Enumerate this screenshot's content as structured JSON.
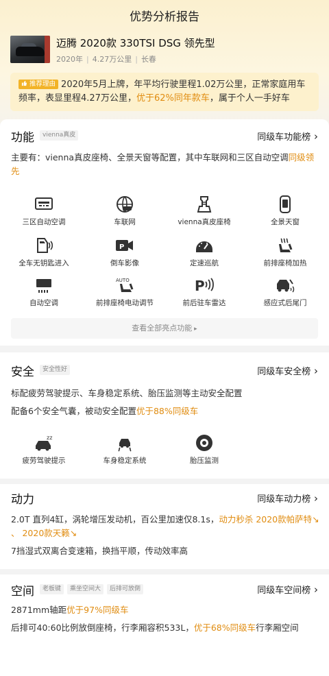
{
  "header": {
    "title": "优势分析报告"
  },
  "car": {
    "name": "迈腾 2020款 330TSI DSG 领先型",
    "year": "2020年",
    "mileage": "4.27万公里",
    "city": "长春"
  },
  "recommend": {
    "tag": "推荐理由",
    "text_1": "2020年5月上牌，年平均行驶里程1.02万公里，正常家庭用车频率，表显里程4.27万公里，",
    "highlight": "优于62%同年款车",
    "text_2": "，属于个人一手好车"
  },
  "features": {
    "title": "功能",
    "tag": "vienna真皮",
    "rank_label": "同级车功能榜",
    "desc_1": "主要有：vienna真皮座椅、全景天窗等配置，其中车联网和三区自动空调",
    "desc_highlight": "同级领先",
    "items": [
      {
        "label": "三区自动空调",
        "icon": "tri-zone-ac-icon"
      },
      {
        "label": "车联网",
        "icon": "connected-car-icon"
      },
      {
        "label": "vienna真皮座椅",
        "icon": "leather-seat-icon"
      },
      {
        "label": "全景天窗",
        "icon": "panoramic-roof-icon"
      },
      {
        "label": "全车无钥匙进入",
        "icon": "keyless-entry-icon"
      },
      {
        "label": "倒车影像",
        "icon": "rear-camera-icon"
      },
      {
        "label": "定速巡航",
        "icon": "cruise-control-icon"
      },
      {
        "label": "前排座椅加热",
        "icon": "seat-heating-icon"
      },
      {
        "label": "自动空调",
        "icon": "auto-ac-icon"
      },
      {
        "label": "前排座椅电动调节",
        "icon": "power-seat-icon"
      },
      {
        "label": "前后驻车雷达",
        "icon": "parking-radar-icon"
      },
      {
        "label": "感应式后尾门",
        "icon": "sensor-tailgate-icon"
      }
    ],
    "view_all": "查看全部亮点功能"
  },
  "safety": {
    "title": "安全",
    "tag": "安全性好",
    "rank_label": "同级车安全榜",
    "desc_1": "标配疲劳驾驶提示、车身稳定系统、胎压监测等主动安全配置",
    "desc_2": "配备6个安全气囊，被动安全配置",
    "desc_2_highlight": "优于88%同级车",
    "items": [
      {
        "label": "疲劳驾驶提示",
        "icon": "fatigue-alert-icon"
      },
      {
        "label": "车身稳定系统",
        "icon": "stability-control-icon"
      },
      {
        "label": "胎压监测",
        "icon": "tire-pressure-icon"
      }
    ]
  },
  "power": {
    "title": "动力",
    "rank_label": "同级车动力榜",
    "desc_1": "2.0T 直列4缸，涡轮增压发动机，百公里加速仅8.1s，",
    "desc_1_highlight": "动力秒杀 2020款帕萨特↘ 、 2020款天籁↘",
    "desc_2": "7挡湿式双离合变速箱，换挡平顺，传动效率高"
  },
  "space": {
    "title": "空间",
    "tags": [
      "老板键",
      "乘坐空间大",
      "后排可放倒"
    ],
    "rank_label": "同级车空间榜",
    "desc_1": "2871mm轴距",
    "desc_1_highlight": "优于97%同级车",
    "desc_2": "后排可40:60比例放倒座椅，行李厢容积533L，",
    "desc_2_highlight": "优于68%同级车",
    "desc_2_tail": "行李厢空间"
  },
  "colors": {
    "accent": "#e08c10",
    "tag_bg": "#f2b327",
    "hero_bg": "#fbf0cf"
  }
}
